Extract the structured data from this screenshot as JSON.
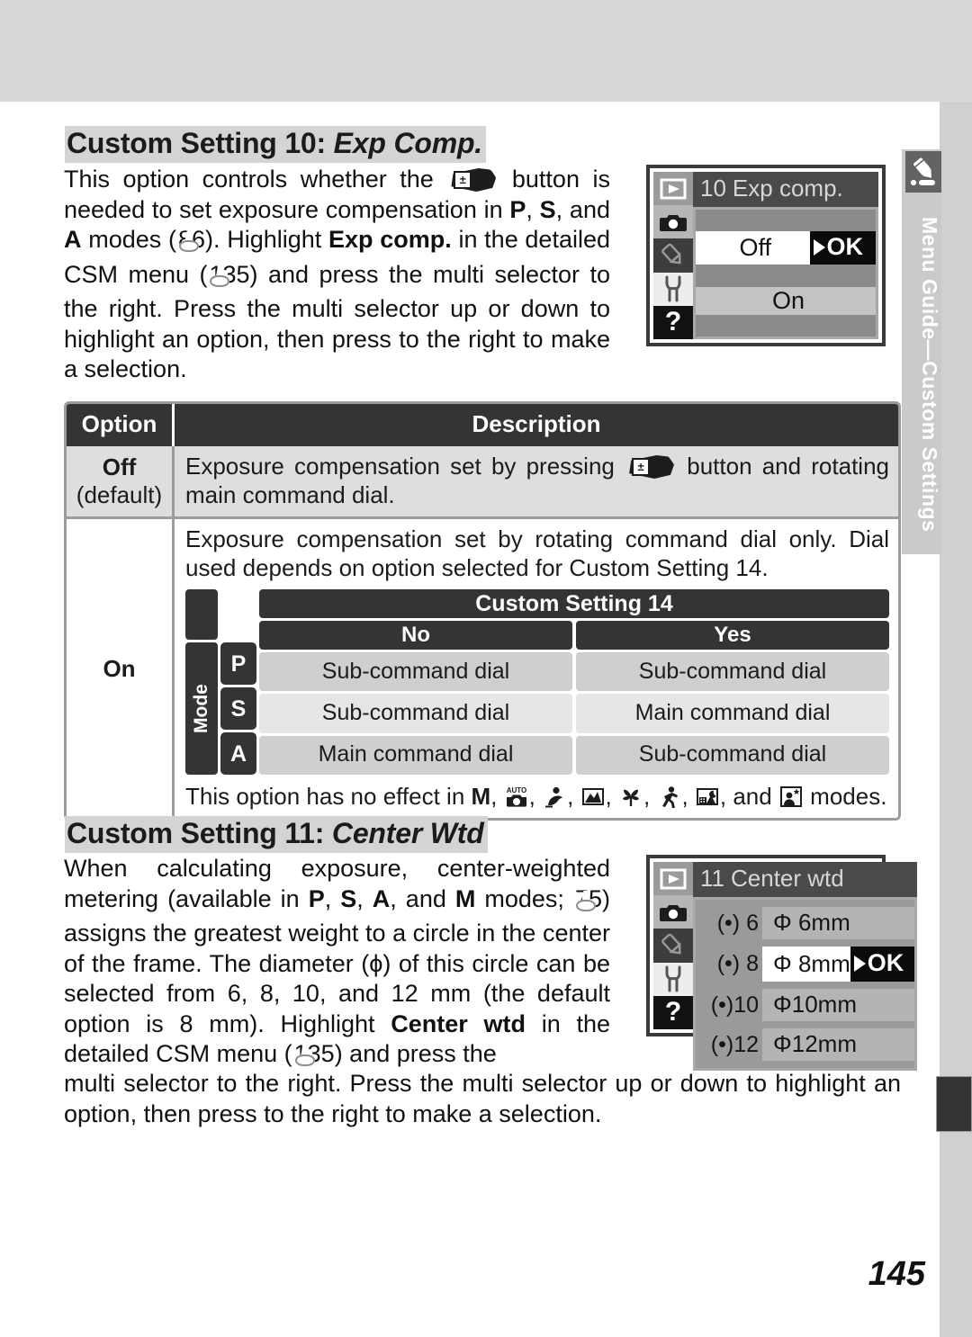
{
  "page": {
    "number": "145",
    "side_tab": {
      "label": "Menu Guide—Custom Settings",
      "icon": "pencil-icon"
    }
  },
  "section_10": {
    "heading_prefix": "Custom Setting 10: ",
    "heading_italic": "Exp Comp.",
    "body": {
      "t1": "This option controls whether the ",
      "t2": " button is needed to set exposure compensation in ",
      "mode_p": "P",
      "comma1": ", ",
      "mode_s": "S",
      "t3": ", and ",
      "mode_a": "A",
      "t4": " modes (",
      "ref1": "86",
      "t5": ").  Highlight ",
      "bold1": "Exp comp.",
      "t6": " in the detailed CSM menu (",
      "ref2": "135",
      "t7": ") and press the multi selector to the right.  Press the multi selector up or down to highlight an option, then press to the right to make a selection."
    },
    "lcd": {
      "title_number": "10",
      "title_text": "Exp comp.",
      "rows": [
        {
          "label": "Off",
          "selected": true,
          "ok": "OK"
        },
        {
          "label": "On",
          "selected": false,
          "ok": ""
        }
      ],
      "side_icons": [
        "playback-icon",
        "shooting-menu-icon",
        "custom-settings-pencil-icon",
        "setup-wrench-icon",
        "help-question-icon"
      ]
    }
  },
  "option_table": {
    "headers": {
      "option": "Option",
      "description": "Description"
    },
    "rows": [
      {
        "option": "Off",
        "option_note": "(default)",
        "description_a": "Exposure compensation set by pressing ",
        "description_b": " button and rotating main command dial."
      },
      {
        "option": "On",
        "description_a": "Exposure compensation set by rotating command dial only.  Dial used depends on option selected for Custom Setting 14.",
        "footnote_a": "This option has no effect in ",
        "footnote_mode_m": "M",
        "footnote_b": ", and ",
        "footnote_c": " modes.",
        "nested_table": {
          "title": "Custom Setting 14",
          "mode_label": "Mode",
          "columns": [
            "No",
            "Yes"
          ],
          "modes": [
            "P",
            "S",
            "A"
          ],
          "cells": [
            [
              "Sub-command dial",
              "Sub-command dial"
            ],
            [
              "Sub-command dial",
              "Main command dial"
            ],
            [
              "Main command dial",
              "Sub-command dial"
            ]
          ]
        }
      }
    ]
  },
  "section_11": {
    "heading_prefix": "Custom Setting 11: ",
    "heading_italic": "Center Wtd",
    "body": {
      "t1": "When calculating exposure, center-weighted metering (available in ",
      "mode_p": "P",
      "mode_s": "S",
      "mode_a": "A",
      "mode_m": "M",
      "sep": ", ",
      "t2": ", and ",
      "t3": " modes; ",
      "ref1": "75",
      "t4": ") assigns the greatest weight to a circle in the center of the frame.  The diameter (ϕ) of this circle can be selected from 6, 8, 10, and 12 mm (the default option is 8 mm).  Highlight ",
      "bold1": "Center wtd",
      "t5": " in the detailed CSM menu (",
      "ref2": "135",
      "t6": ") and press the",
      "t7": "multi selector to the right.  Press the multi selector up or down to highlight an option, then press to the right to make a selection."
    },
    "lcd": {
      "title_number": "11",
      "title_text": "Center wtd",
      "rows": [
        {
          "icon_value": "6",
          "label": "Φ 6mm",
          "selected": false,
          "ok": ""
        },
        {
          "icon_value": "8",
          "label": "Φ 8mm",
          "selected": true,
          "ok": "OK"
        },
        {
          "icon_value": "10",
          "label": "Φ10mm",
          "selected": false,
          "ok": ""
        },
        {
          "icon_value": "12",
          "label": "Φ12mm",
          "selected": false,
          "ok": ""
        }
      ]
    }
  },
  "colors": {
    "band": "#d8d8d8",
    "heading_highlight": "#d4d4d4",
    "table_header": "#343434",
    "row_off": "#dedede",
    "lcd_title": "#4a4a4a"
  }
}
